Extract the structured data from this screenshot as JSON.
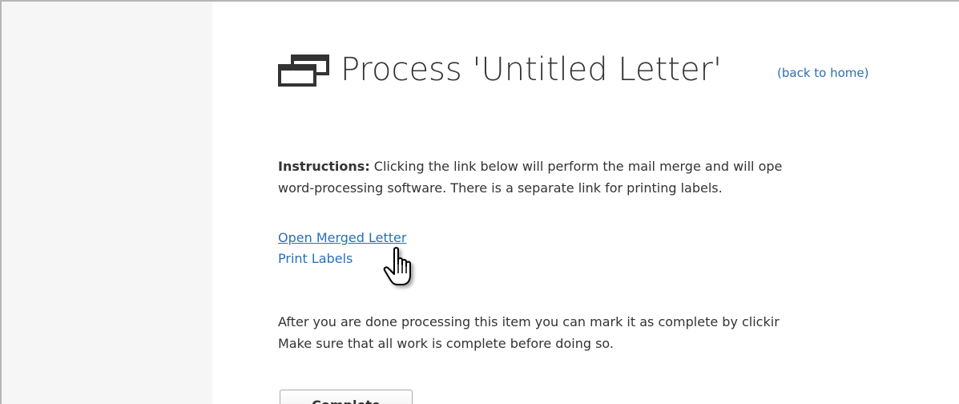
{
  "page": {
    "title": "Process 'Untitled Letter'",
    "back_link": "(back to home)"
  },
  "instructions": {
    "label": "Instructions:",
    "line1": " Clicking the link below will perform the mail merge and will ope",
    "line2": "word-processing software. There is a separate link for printing labels."
  },
  "links": {
    "open_merged_letter": "Open Merged Letter",
    "print_labels": "Print Labels"
  },
  "after": {
    "line1": "After you are done processing this item you can mark it as complete by clickir",
    "line2": "Make sure that all work is complete before doing so."
  },
  "actions": {
    "complete_label": "Complete"
  },
  "icons": {
    "title_icon": "windows-icon",
    "cursor": "hand-pointer-icon"
  },
  "colors": {
    "link": "#2a6fb7",
    "text": "#333333",
    "sidebar_bg": "#f6f6f6"
  }
}
